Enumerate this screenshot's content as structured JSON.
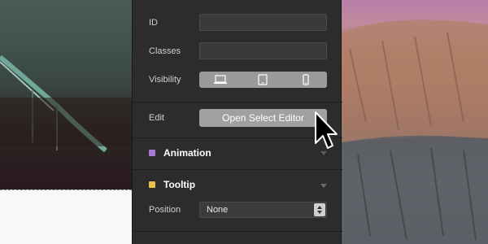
{
  "panel": {
    "id_label": "ID",
    "classes_label": "Classes",
    "visibility_label": "Visibility",
    "visibility_options": [
      "desktop-icon",
      "tablet-icon",
      "phone-icon"
    ],
    "edit_label": "Edit",
    "edit_button": "Open Select Editor",
    "sections": {
      "animation": {
        "title": "Animation",
        "color": "#a779d6"
      },
      "tooltip": {
        "title": "Tooltip",
        "color": "#e8c14a"
      }
    },
    "position_label": "Position",
    "position_value": "None"
  }
}
